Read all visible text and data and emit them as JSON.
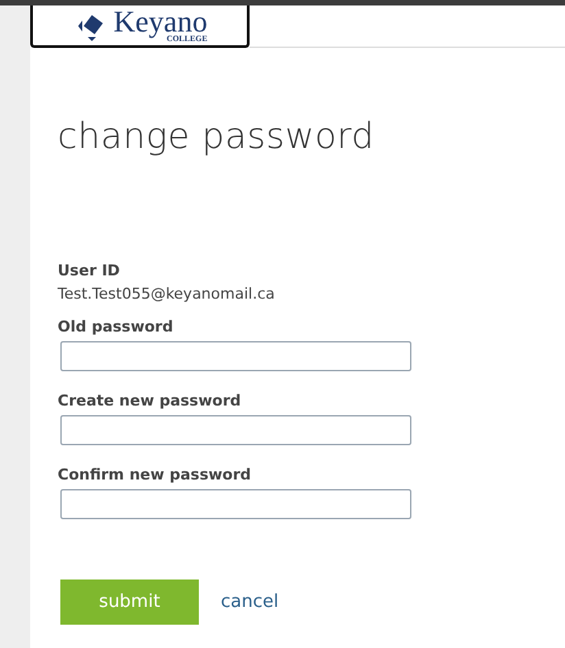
{
  "logo": {
    "name": "Keyano",
    "subtitle": "COLLEGE"
  },
  "title": "change password",
  "user_id": {
    "label": "User ID",
    "value": "Test.Test055@keyanomail.ca"
  },
  "fields": [
    {
      "label": "Old password"
    },
    {
      "label": "Create new password"
    },
    {
      "label": "Confirm new password"
    }
  ],
  "buttons": {
    "submit": "submit",
    "cancel": "cancel"
  }
}
